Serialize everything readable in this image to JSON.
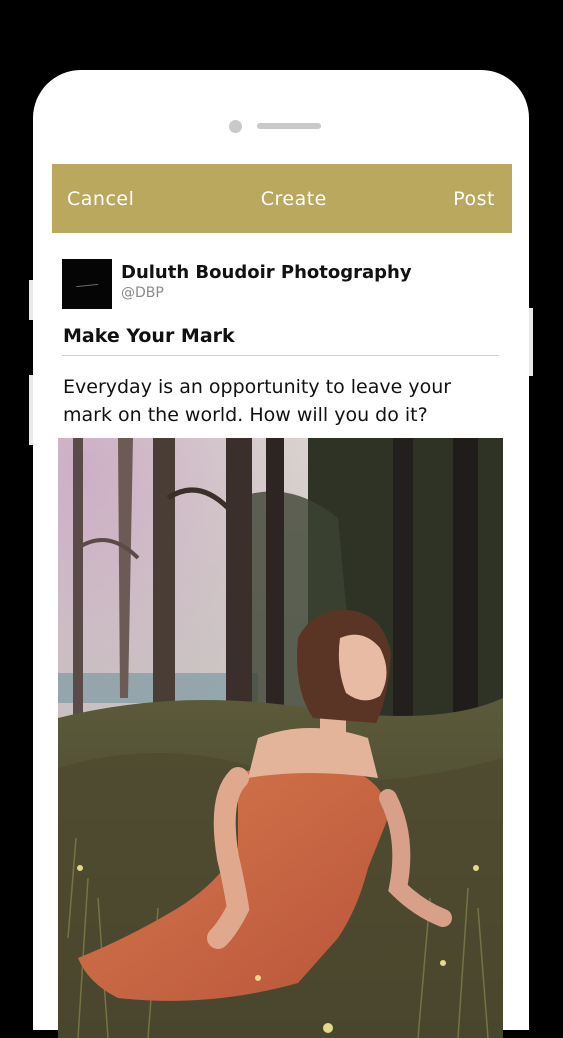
{
  "navbar": {
    "cancel_label": "Cancel",
    "title": "Create",
    "post_label": "Post",
    "bar_color": "#b9a85e"
  },
  "author": {
    "name": "Duluth Boudoir Photography",
    "handle": "@DBP"
  },
  "post": {
    "title": "Make Your Mark",
    "body": "Everyday is an opportunity to leave your mark on the world. How will you do it?"
  },
  "photo": {
    "description_icon": "photo-image"
  }
}
